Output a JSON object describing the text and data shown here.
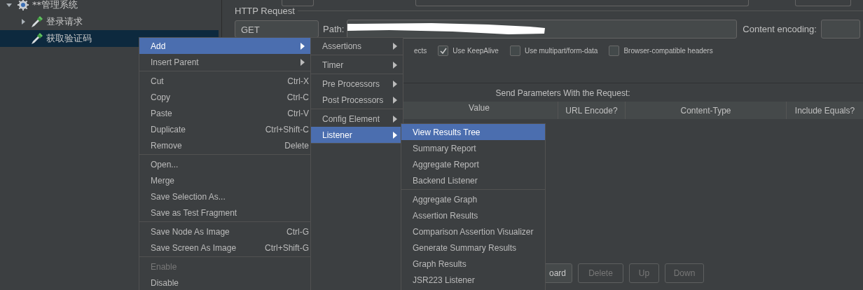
{
  "tree": [
    {
      "label": "**管理系统",
      "kind": "test_plan",
      "expanded": true,
      "selected": false,
      "children": [
        {
          "label": "登录请求",
          "kind": "sampler",
          "expanded": false,
          "selected": false
        },
        {
          "label": "获取验证码",
          "kind": "sampler",
          "selected": true
        }
      ]
    }
  ],
  "http_request": {
    "title": "HTTP Request",
    "method": "GET",
    "path_label": "Path:",
    "path_redacted": true,
    "content_encoding_label": "Content encoding:"
  },
  "options": [
    {
      "label": "ects"
    },
    {
      "label": "Use KeepAlive",
      "checked": true
    },
    {
      "label": "Use multipart/form-data",
      "checked": false
    },
    {
      "label": "Browser-compatible headers",
      "checked": false
    }
  ],
  "parameters": {
    "title": "Send Parameters With the Request:",
    "columns": [
      "Value",
      "URL Encode?",
      "Content-Type",
      "Include Equals?"
    ]
  },
  "buttons": [
    {
      "label": "oard",
      "disabled": false
    },
    {
      "label": "Delete",
      "disabled": true
    },
    {
      "label": "Up",
      "disabled": true
    },
    {
      "label": "Down",
      "disabled": true
    }
  ],
  "menus": [
    {
      "items": [
        {
          "kind": "item",
          "label": "Add",
          "submenu": true,
          "selected": true,
          "disabled": false
        },
        {
          "kind": "item",
          "label": "Insert Parent",
          "submenu": true,
          "selected": false,
          "disabled": false
        },
        {
          "kind": "separator"
        },
        {
          "kind": "item",
          "label": "Cut",
          "shortcut": "Ctrl-X",
          "selected": false,
          "disabled": false
        },
        {
          "kind": "item",
          "label": "Copy",
          "shortcut": "Ctrl-C",
          "selected": false,
          "disabled": false
        },
        {
          "kind": "item",
          "label": "Paste",
          "shortcut": "Ctrl-V",
          "selected": false,
          "disabled": false
        },
        {
          "kind": "item",
          "label": "Duplicate",
          "shortcut": "Ctrl+Shift-C",
          "selected": false,
          "disabled": false
        },
        {
          "kind": "item",
          "label": "Remove",
          "shortcut": "Delete",
          "selected": false,
          "disabled": false
        },
        {
          "kind": "separator"
        },
        {
          "kind": "item",
          "label": "Open...",
          "selected": false,
          "disabled": false
        },
        {
          "kind": "item",
          "label": "Merge",
          "selected": false,
          "disabled": false
        },
        {
          "kind": "item",
          "label": "Save Selection As...",
          "selected": false,
          "disabled": false
        },
        {
          "kind": "item",
          "label": "Save as Test Fragment",
          "selected": false,
          "disabled": false
        },
        {
          "kind": "separator"
        },
        {
          "kind": "item",
          "label": "Save Node As Image",
          "shortcut": "Ctrl-G",
          "selected": false,
          "disabled": false
        },
        {
          "kind": "item",
          "label": "Save Screen As Image",
          "shortcut": "Ctrl+Shift-G",
          "selected": false,
          "disabled": false
        },
        {
          "kind": "separator"
        },
        {
          "kind": "item",
          "label": "Enable",
          "selected": false,
          "disabled": true
        },
        {
          "kind": "item",
          "label": "Disable",
          "selected": false,
          "disabled": false
        }
      ]
    },
    {
      "items": [
        {
          "kind": "item",
          "label": "Assertions",
          "submenu": true,
          "selected": false
        },
        {
          "kind": "separator"
        },
        {
          "kind": "item",
          "label": "Timer",
          "submenu": true,
          "selected": false
        },
        {
          "kind": "separator"
        },
        {
          "kind": "item",
          "label": "Pre Processors",
          "submenu": true,
          "selected": false
        },
        {
          "kind": "item",
          "label": "Post Processors",
          "submenu": true,
          "selected": false
        },
        {
          "kind": "separator"
        },
        {
          "kind": "item",
          "label": "Config Element",
          "submenu": true,
          "selected": false
        },
        {
          "kind": "item",
          "label": "Listener",
          "submenu": true,
          "selected": true
        }
      ]
    },
    {
      "items": [
        {
          "kind": "item",
          "label": "View Results Tree",
          "selected": true
        },
        {
          "kind": "item",
          "label": "Summary Report",
          "selected": false
        },
        {
          "kind": "item",
          "label": "Aggregate Report",
          "selected": false
        },
        {
          "kind": "item",
          "label": "Backend Listener",
          "selected": false
        },
        {
          "kind": "separator"
        },
        {
          "kind": "item",
          "label": "Aggregate Graph",
          "selected": false
        },
        {
          "kind": "item",
          "label": "Assertion Results",
          "selected": false
        },
        {
          "kind": "item",
          "label": "Comparison Assertion Visualizer",
          "selected": false
        },
        {
          "kind": "item",
          "label": "Generate Summary Results",
          "selected": false
        },
        {
          "kind": "item",
          "label": "Graph Results",
          "selected": false
        },
        {
          "kind": "item",
          "label": "JSR223 Listener",
          "selected": false
        }
      ]
    }
  ]
}
